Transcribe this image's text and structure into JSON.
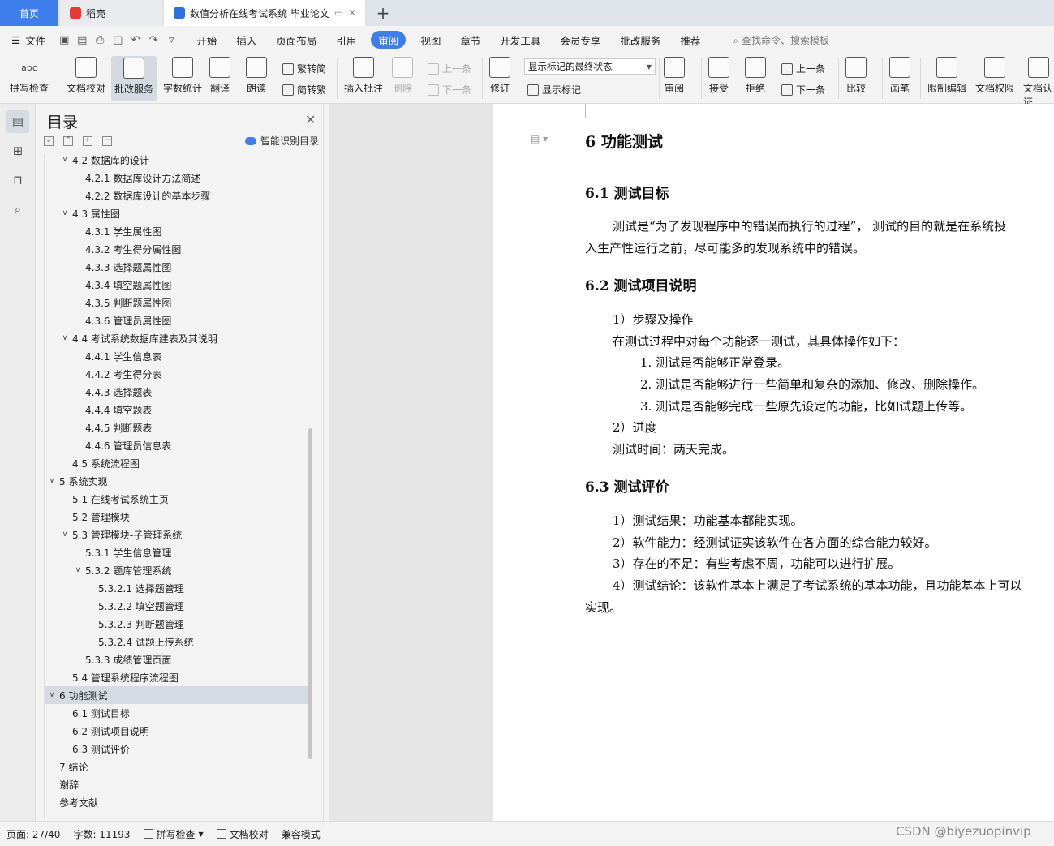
{
  "tabs": [
    {
      "label": "首页"
    },
    {
      "label": "稻壳"
    },
    {
      "label": "数值分析在线考试系统 毕业论文"
    }
  ],
  "menu": {
    "file": "文件",
    "items": [
      "开始",
      "插入",
      "页面布局",
      "引用",
      "审阅",
      "视图",
      "章节",
      "开发工具",
      "会员专享",
      "批改服务",
      "推荐"
    ],
    "search": "查找命令、搜索模板"
  },
  "ribbon": {
    "spell_icon": "abc",
    "spell": "拼写检查",
    "proofread": "文档校对",
    "correct": "批改服务",
    "wordcount": "字数统计",
    "translate": "翻译",
    "read": "朗读",
    "trad": "繁转简",
    "simp": "简转繁",
    "insert_comment": "插入批注",
    "delete": "删除",
    "prev": "上一条",
    "next": "下一条",
    "revise": "修订",
    "markup_state": "显示标记的最终状态",
    "show_markup": "显示标记",
    "review": "审阅",
    "accept": "接受",
    "reject": "拒绝",
    "prev2": "上一条",
    "next2": "下一条",
    "compare": "比较",
    "pen": "画笔",
    "restrict": "限制编辑",
    "perm": "文档权限",
    "cert": "文档认证"
  },
  "toc": {
    "title": "目录",
    "smart": "智能识别目录",
    "items": [
      {
        "label": "4.2 数据库的设计",
        "level": 2,
        "chev": true
      },
      {
        "label": "4.2.1 数据库设计方法简述",
        "level": 3
      },
      {
        "label": "4.2.2 数据库设计的基本步骤",
        "level": 3
      },
      {
        "label": "4.3 属性图",
        "level": 2,
        "chev": true
      },
      {
        "label": "4.3.1 学生属性图",
        "level": 3
      },
      {
        "label": "4.3.2 考生得分属性图",
        "level": 3
      },
      {
        "label": "4.3.3 选择题属性图",
        "level": 3
      },
      {
        "label": "4.3.4 填空题属性图",
        "level": 3
      },
      {
        "label": "4.3.5 判断题属性图",
        "level": 3
      },
      {
        "label": "4.3.6 管理员属性图",
        "level": 3
      },
      {
        "label": "4.4 考试系统数据库建表及其说明",
        "level": 2,
        "chev": true
      },
      {
        "label": "4.4.1 学生信息表",
        "level": 3
      },
      {
        "label": "4.4.2 考生得分表",
        "level": 3
      },
      {
        "label": "4.4.3 选择题表",
        "level": 3
      },
      {
        "label": "4.4.4 填空题表",
        "level": 3
      },
      {
        "label": "4.4.5 判断题表",
        "level": 3
      },
      {
        "label": "4.4.6 管理员信息表",
        "level": 3
      },
      {
        "label": "4.5 系统流程图",
        "level": 2
      },
      {
        "label": "5 系统实现",
        "level": 1,
        "chev": true
      },
      {
        "label": "5.1 在线考试系统主页",
        "level": 2
      },
      {
        "label": "5.2 管理模块",
        "level": 2
      },
      {
        "label": "5.3 管理模块-子管理系统",
        "level": 2,
        "chev": true
      },
      {
        "label": "5.3.1 学生信息管理",
        "level": 3
      },
      {
        "label": "5.3.2 题库管理系统",
        "level": 3,
        "chev": true
      },
      {
        "label": "5.3.2.1 选择题管理",
        "level": 4
      },
      {
        "label": "5.3.2.2 填空题管理",
        "level": 4
      },
      {
        "label": "5.3.2.3 判断题管理",
        "level": 4
      },
      {
        "label": "5.3.2.4 试题上传系统",
        "level": 4
      },
      {
        "label": "5.3.3 成绩管理页面",
        "level": 3
      },
      {
        "label": "5.4 管理系统程序流程图",
        "level": 2
      },
      {
        "label": "6 功能测试",
        "level": 1,
        "chev": true,
        "selected": true
      },
      {
        "label": "6.1 测试目标",
        "level": 2
      },
      {
        "label": "6.2 测试项目说明",
        "level": 2
      },
      {
        "label": "6.3 测试评价",
        "level": 2
      },
      {
        "label": "7 结论",
        "level": 1
      },
      {
        "label": "谢辞",
        "level": 1
      },
      {
        "label": "参考文献",
        "level": 1
      }
    ]
  },
  "doc": {
    "h_6": "6 功能测试",
    "h_61": "6.1 测试目标",
    "p_61a": "测试是“为了发现程序中的错误而执行的过程”， 测试的目的就是在系统投",
    "p_61b": "入生产性运行之前，尽可能多的发现系统中的错误。",
    "h_62": "6.2 测试项目说明",
    "p_62a": "1）步骤及操作",
    "p_62b": "在测试过程中对每个功能逐一测试，其具体操作如下：",
    "p_62c": "1.  测试是否能够正常登录。",
    "p_62d": "2.  测试是否能够进行一些简单和复杂的添加、修改、删除操作。",
    "p_62e": "3.  测试是否能够完成一些原先设定的功能，比如试题上传等。",
    "p_62f": "2）进度",
    "p_62g": "测试时间：两天完成。",
    "h_63": "6.3 测试评价",
    "p_63a": "1）测试结果：功能基本都能实现。",
    "p_63b": "2）软件能力：经测试证实该软件在各方面的综合能力较好。",
    "p_63c": "3）存在的不足：有些考虑不周，功能可以进行扩展。",
    "p_63d": "4）测试结论：该软件基本上满足了考试系统的基本功能，且功能基本上可以",
    "p_63e": "实现。"
  },
  "status": {
    "page": "页面: 27/40",
    "words": "字数: 11193",
    "spell": "拼写检查",
    "proof": "文档校对",
    "compat": "兼容模式"
  },
  "watermark": "CSDN @biyezuopinvip",
  "colors": {
    "accent": "#3d7eea",
    "tab_active": "#3d7eea"
  }
}
